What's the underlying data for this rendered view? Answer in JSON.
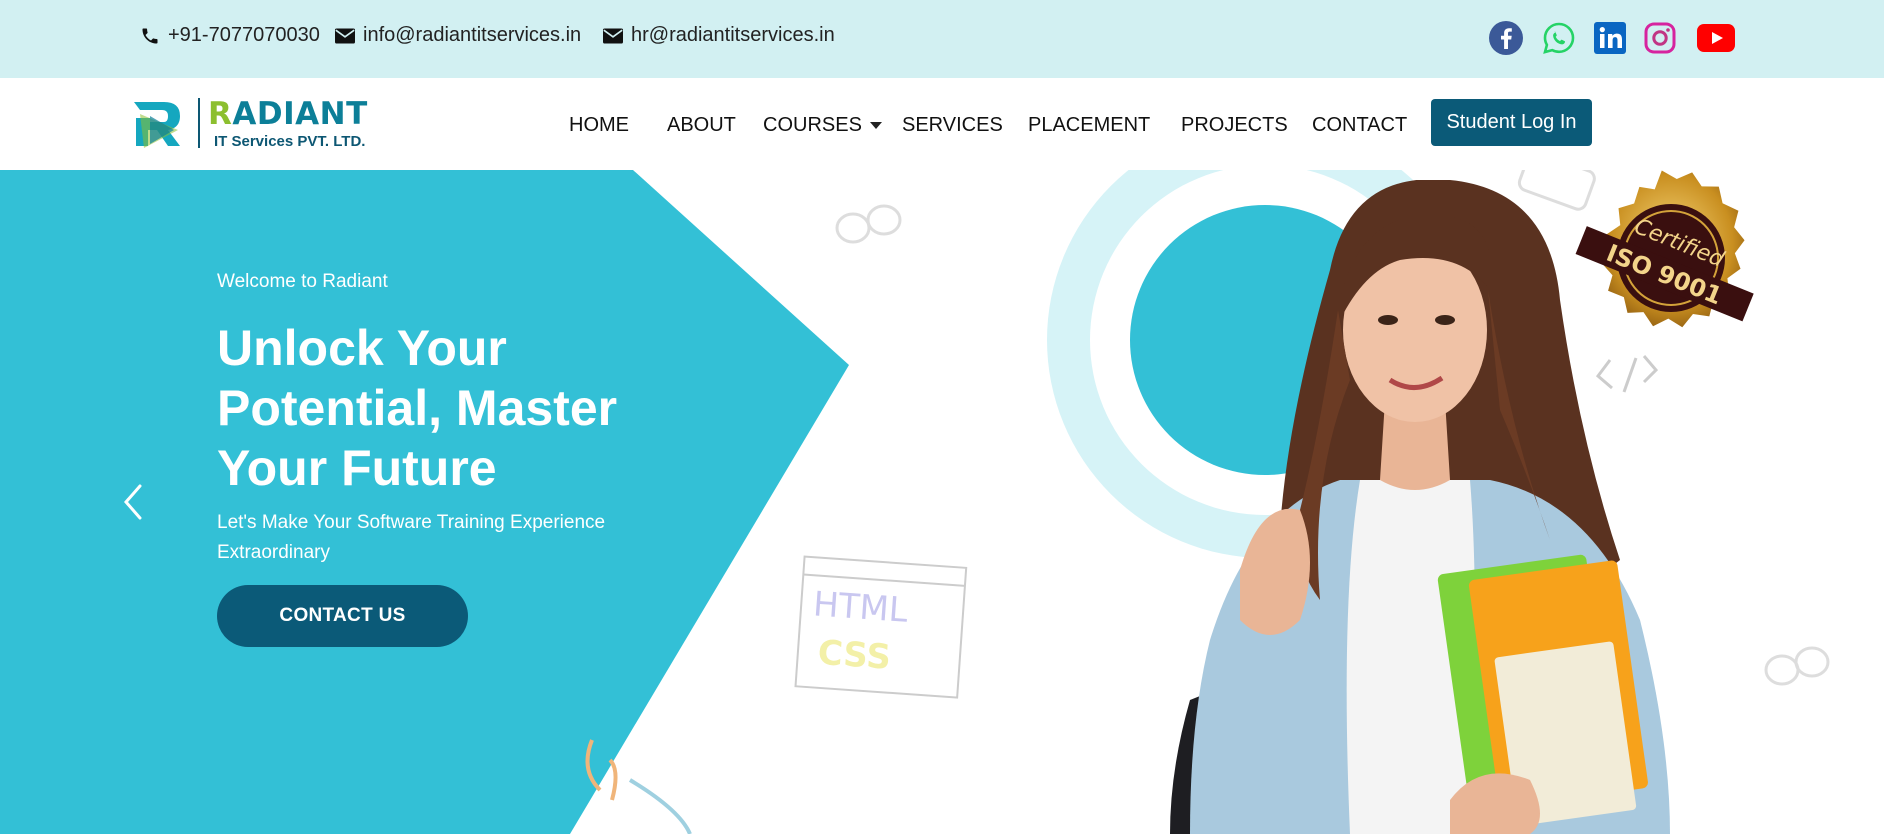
{
  "topbar": {
    "phone": "+91-7077070030",
    "email_info": "info@radiantitservices.in",
    "email_hr": "hr@radiantitservices.in",
    "social": [
      "facebook-icon",
      "whatsapp-icon",
      "linkedin-icon",
      "instagram-icon",
      "youtube-icon"
    ]
  },
  "brand": {
    "first_letter": "R",
    "rest": "ADIANT",
    "subtitle": "IT Services PVT. LTD."
  },
  "nav": {
    "home": "HOME",
    "about": "ABOUT",
    "courses": "COURSES",
    "services": "SERVICES",
    "placement": "PLACEMENT",
    "projects": "PROJECTS",
    "contact": "CONTACT",
    "login": "Student Log In"
  },
  "hero": {
    "welcome": "Welcome to Radiant",
    "headline": "Unlock Your Potential, Master Your Future",
    "subtitle": "Let's Make Your Software Training Experience Extraordinary",
    "cta": "CONTACT US",
    "badge_line1": "Certified",
    "badge_line2": "ISO 9001",
    "deco_html": "HTML",
    "deco_css": "CSS"
  },
  "colors": {
    "topbar": "#d2f0f2",
    "accent": "#33c0d6",
    "dark_blue": "#0b5a78",
    "brand_green": "#8cbf2f"
  }
}
